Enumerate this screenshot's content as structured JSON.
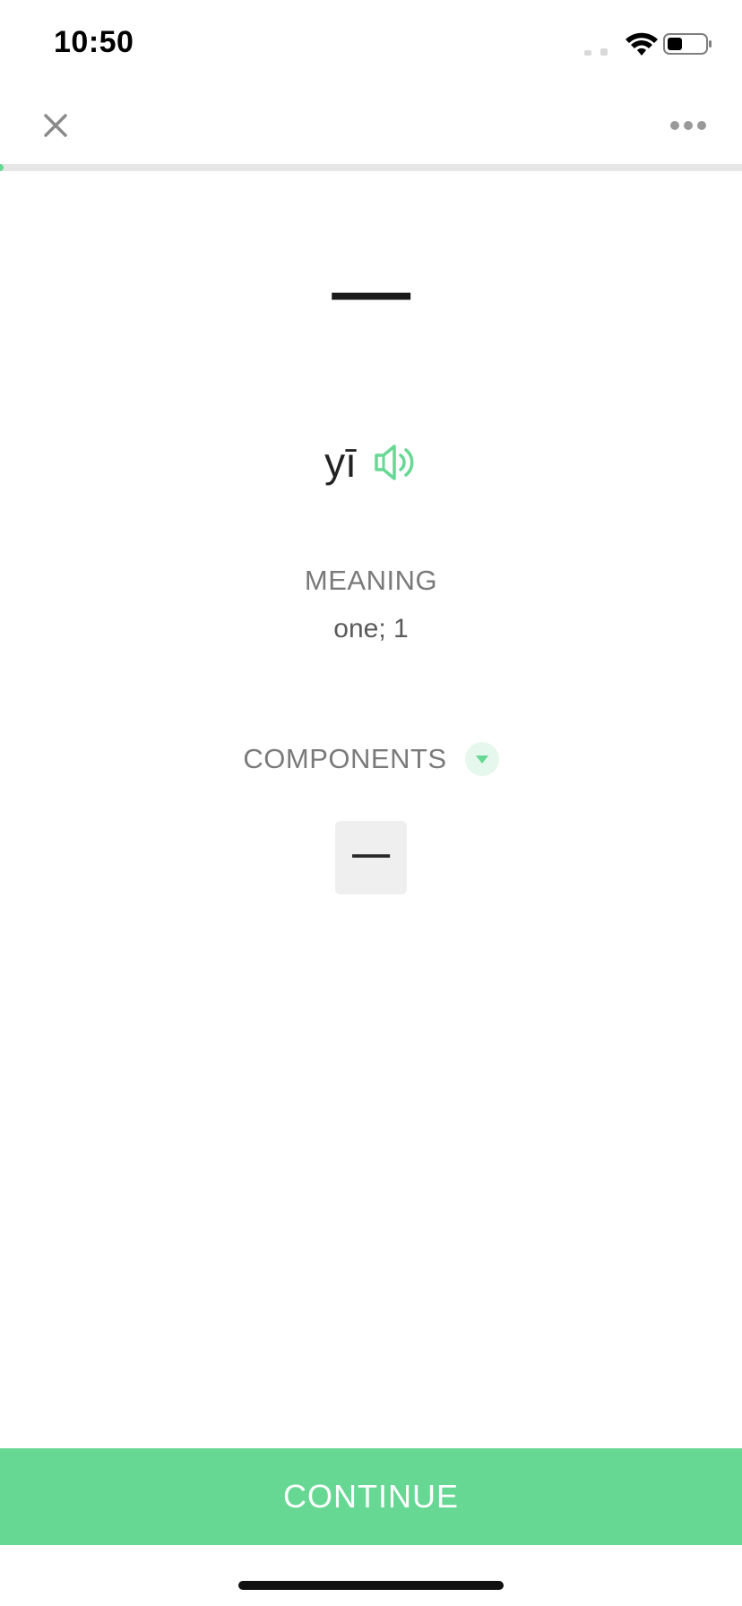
{
  "status_bar": {
    "time": "10:50",
    "icons": [
      "cellular-signal-icon",
      "wifi-icon",
      "battery-icon"
    ],
    "battery_level": 0.35
  },
  "top_bar": {
    "close_icon": "close-icon",
    "more_icon": "more-horizontal-icon"
  },
  "progress": {
    "fraction": 0.005,
    "color": "#67d894"
  },
  "card": {
    "character": "一",
    "pinyin": "yī",
    "speaker_icon": "speaker-icon",
    "meaning_label": "MEANING",
    "meaning_value": "one; 1",
    "components_label": "COMPONENTS",
    "components_toggle_icon": "caret-down-icon",
    "components": [
      "一"
    ]
  },
  "continue_label": "CONTINUE",
  "colors": {
    "accent": "#67d894",
    "accent_light": "#e6f8ee"
  }
}
